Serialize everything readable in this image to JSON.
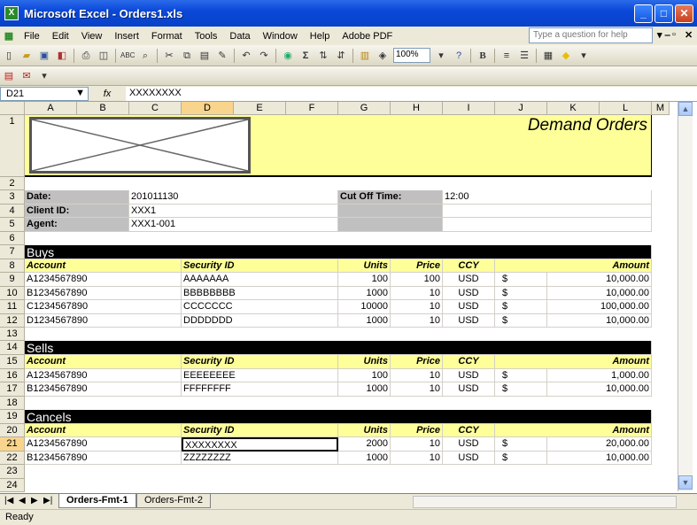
{
  "window": {
    "title": "Microsoft Excel - Orders1.xls"
  },
  "menu": [
    "File",
    "Edit",
    "View",
    "Insert",
    "Format",
    "Tools",
    "Data",
    "Window",
    "Help",
    "Adobe PDF"
  ],
  "ask_placeholder": "Type a question for help",
  "zoom": "100%",
  "namebox": "D21",
  "formula": "XXXXXXXX",
  "columns": [
    "A",
    "B",
    "C",
    "D",
    "E",
    "F",
    "G",
    "H",
    "I",
    "J",
    "K",
    "L",
    "M"
  ],
  "rows": [
    "1",
    "2",
    "3",
    "4",
    "5",
    "6",
    "7",
    "8",
    "9",
    "10",
    "11",
    "12",
    "13",
    "14",
    "15",
    "16",
    "17",
    "18",
    "19",
    "20",
    "21",
    "22",
    "23",
    "24"
  ],
  "header": {
    "title": "Demand Orders"
  },
  "info": {
    "date_label": "Date:",
    "date": "201011130",
    "client_label": "Client ID:",
    "client": "XXX1",
    "agent_label": "Agent:",
    "agent": "XXX1-001",
    "cutoff_label": "Cut Off Time:",
    "cutoff": "12:00"
  },
  "colhdr": {
    "account": "Account",
    "security": "Security ID",
    "units": "Units",
    "price": "Price",
    "ccy": "CCY",
    "amount": "Amount"
  },
  "sections": {
    "buys": "Buys",
    "sells": "Sells",
    "cancels": "Cancels"
  },
  "buys": [
    {
      "account": "A1234567890",
      "security": "AAAAAAA",
      "units": "100",
      "price": "100",
      "ccy": "USD",
      "cur": "$",
      "amount": "10,000.00"
    },
    {
      "account": "B1234567890",
      "security": "BBBBBBBB",
      "units": "1000",
      "price": "10",
      "ccy": "USD",
      "cur": "$",
      "amount": "10,000.00"
    },
    {
      "account": "C1234567890",
      "security": "CCCCCCC",
      "units": "10000",
      "price": "10",
      "ccy": "USD",
      "cur": "$",
      "amount": "100,000.00"
    },
    {
      "account": "D1234567890",
      "security": "DDDDDDD",
      "units": "1000",
      "price": "10",
      "ccy": "USD",
      "cur": "$",
      "amount": "10,000.00"
    }
  ],
  "sells": [
    {
      "account": "A1234567890",
      "security": "EEEEEEEE",
      "units": "100",
      "price": "10",
      "ccy": "USD",
      "cur": "$",
      "amount": "1,000.00"
    },
    {
      "account": "B1234567890",
      "security": "FFFFFFFF",
      "units": "1000",
      "price": "10",
      "ccy": "USD",
      "cur": "$",
      "amount": "10,000.00"
    }
  ],
  "cancels": [
    {
      "account": "A1234567890",
      "security": "XXXXXXXX",
      "units": "2000",
      "price": "10",
      "ccy": "USD",
      "cur": "$",
      "amount": "20,000.00"
    },
    {
      "account": "B1234567890",
      "security": "ZZZZZZZZ",
      "units": "1000",
      "price": "10",
      "ccy": "USD",
      "cur": "$",
      "amount": "10,000.00"
    }
  ],
  "tabs": [
    "Orders-Fmt-1",
    "Orders-Fmt-2"
  ],
  "status": "Ready",
  "colors": {
    "yellow": "#ffff99",
    "gray": "#c0c0c0",
    "black": "#000000",
    "selected_header": "#f8d48c"
  }
}
